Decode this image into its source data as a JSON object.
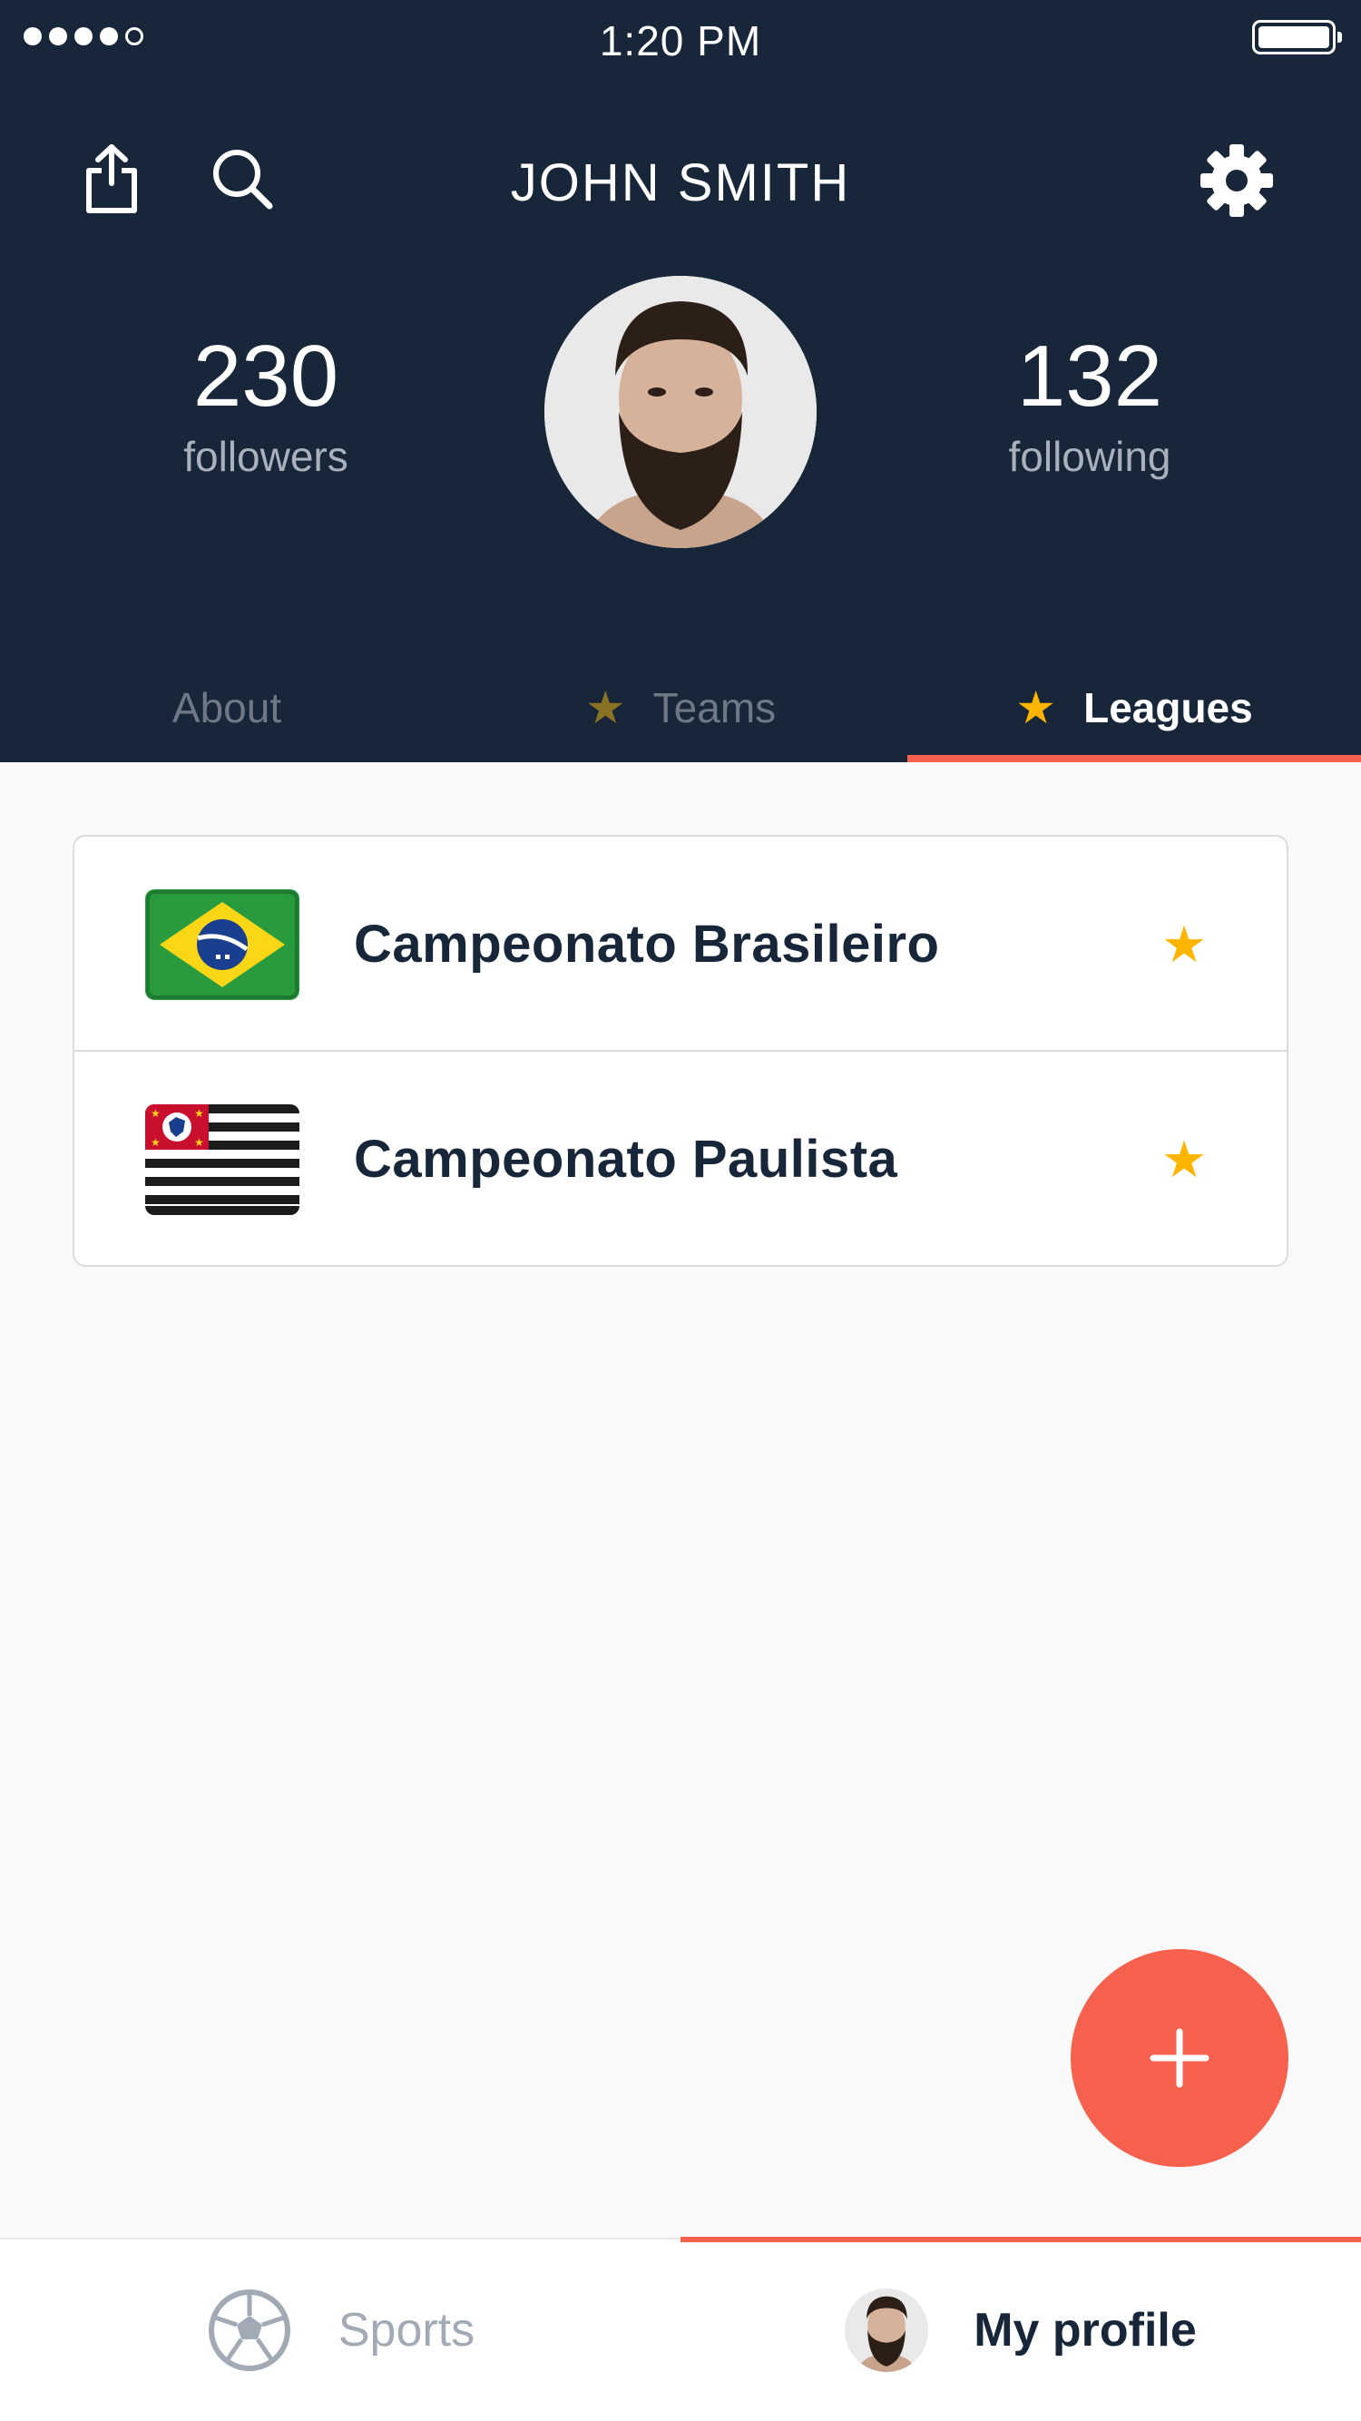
{
  "status_bar": {
    "time": "1:20 PM",
    "signal_filled": 4,
    "signal_total": 5
  },
  "header": {
    "title": "JOHN SMITH",
    "icons": {
      "share": "share-icon",
      "search": "search-icon",
      "settings": "gear-icon"
    }
  },
  "profile": {
    "followers_count": "230",
    "followers_label": "followers",
    "following_count": "132",
    "following_label": "following"
  },
  "tabs": [
    {
      "label": "About",
      "starred": false,
      "active": false
    },
    {
      "label": "Teams",
      "starred": true,
      "active": false
    },
    {
      "label": "Leagues",
      "starred": true,
      "active": true
    }
  ],
  "leagues": [
    {
      "name": "Campeonato Brasileiro",
      "flag": "brazil-flag",
      "favorite": true
    },
    {
      "name": "Campeonato Paulista",
      "flag": "sao-paulo-flag",
      "favorite": true
    }
  ],
  "fab": {
    "icon": "plus-icon"
  },
  "bottom_nav": [
    {
      "label": "Sports",
      "icon": "soccer-ball-icon",
      "active": false
    },
    {
      "label": "My profile",
      "icon": "avatar",
      "active": true
    }
  ],
  "colors": {
    "header_bg": "#172638",
    "accent": "#f5614c",
    "star": "#ffb400",
    "text_dark": "#172638",
    "text_muted": "#a2aab6"
  }
}
